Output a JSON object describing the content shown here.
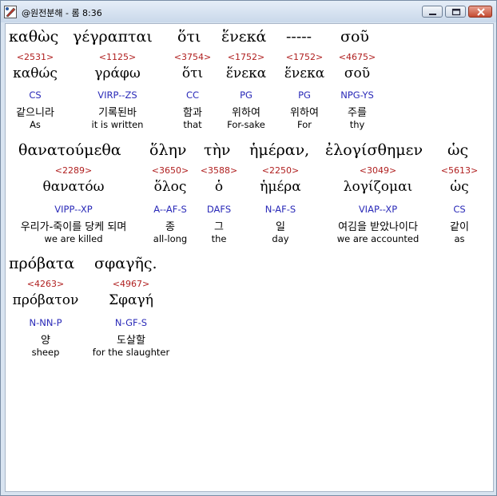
{
  "window": {
    "title": "@원전분해 - 롬 8:36",
    "buttons": {
      "minimize": "minimize-icon",
      "maximize": "maximize-icon",
      "close": "close-icon"
    }
  },
  "rows": [
    {
      "words": [
        {
          "greek": "καθὼς",
          "strong": "<2531>",
          "lemma": "καθώς",
          "parse": "CS",
          "korean": "같으니라",
          "english": "As"
        },
        {
          "greek": "γέγραπται",
          "strong": "<1125>",
          "lemma": "γράφω",
          "parse": "VIRP--ZS",
          "korean": "기록된바",
          "english": "it is written"
        },
        {
          "greek": "ὅτι",
          "strong": "<3754>",
          "lemma": "ὅτι",
          "parse": "CC",
          "korean": "함과",
          "english": "that"
        },
        {
          "greek": "ἕνεκά",
          "strong": "<1752>",
          "lemma": "ἕνεκα",
          "parse": "PG",
          "korean": "위하여",
          "english": "For-sake"
        },
        {
          "greek": "-----",
          "strong": "<1752>",
          "lemma": "ἕνεκα",
          "parse": "PG",
          "korean": "위하여",
          "english": "For"
        },
        {
          "greek": "σοῦ",
          "strong": "<4675>",
          "lemma": "σοῦ",
          "parse": "NPG-YS",
          "korean": "주를",
          "english": "thy"
        }
      ]
    },
    {
      "words": [
        {
          "greek": "θανατούμεθα",
          "strong": "<2289>",
          "lemma": "θανατόω",
          "parse": "VIPP--XP",
          "korean": "우리가-죽이를 당케 되며",
          "english": "we are killed"
        },
        {
          "greek": "ὅλην",
          "strong": "<3650>",
          "lemma": "ὅλος",
          "parse": "A--AF-S",
          "korean": "종",
          "english": "all-long"
        },
        {
          "greek": "τὴν",
          "strong": "<3588>",
          "lemma": "ὁ",
          "parse": "DAFS",
          "korean": "그",
          "english": "the"
        },
        {
          "greek": "ἡμέραν,",
          "strong": "<2250>",
          "lemma": "ἡμέρα",
          "parse": "N-AF-S",
          "korean": "일",
          "english": "day"
        },
        {
          "greek": "ἐλογίσθημεν",
          "strong": "<3049>",
          "lemma": "λογίζομαι",
          "parse": "VIAP--XP",
          "korean": "여김을 받았나이다",
          "english": "we are accounted"
        },
        {
          "greek": "ὡς",
          "strong": "<5613>",
          "lemma": "ὡς",
          "parse": "CS",
          "korean": "같이",
          "english": "as"
        }
      ]
    },
    {
      "words": [
        {
          "greek": "πρόβατα",
          "strong": "<4263>",
          "lemma": "πρόβατον",
          "parse": "N-NN-P",
          "korean": "양",
          "english": "sheep"
        },
        {
          "greek": "σφαγῆς.",
          "strong": "<4967>",
          "lemma": "Σφαγή",
          "parse": "N-GF-S",
          "korean": "도살할",
          "english": "for the slaughter"
        }
      ]
    }
  ]
}
